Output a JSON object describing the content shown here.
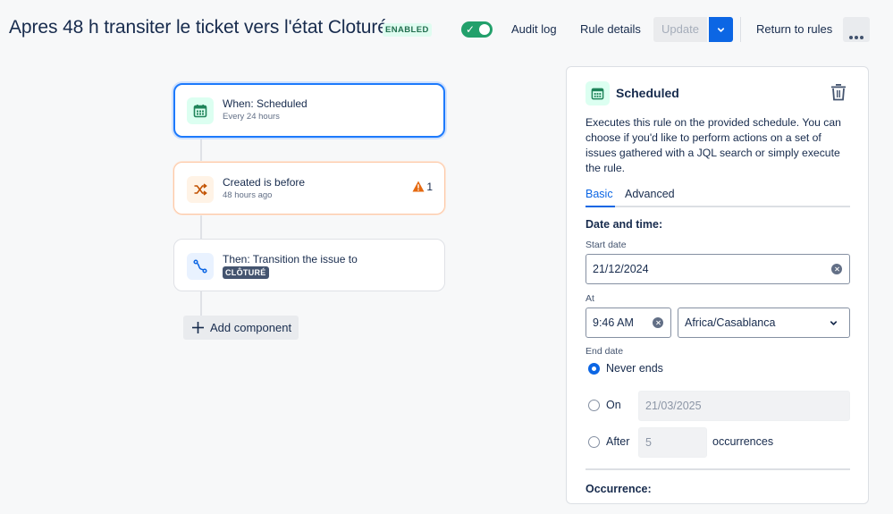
{
  "header": {
    "title": "Apres 48 h transiter le ticket vers l'état Cloturé",
    "status_lozenge": "ENABLED",
    "toggle_enabled": true,
    "audit_log_label": "Audit log",
    "rule_details_label": "Rule details",
    "update_label": "Update",
    "return_label": "Return to rules"
  },
  "flow": {
    "trigger": {
      "title": "When: Scheduled",
      "subtitle": "Every 24 hours",
      "icon": "calendar-icon"
    },
    "condition": {
      "title": "Created is before",
      "subtitle": "48 hours ago",
      "icon": "shuffle-icon",
      "warning_count": "1"
    },
    "action": {
      "title": "Then: Transition the issue to",
      "status": "CLÔTURÉ",
      "icon": "transition-icon"
    },
    "add_component_label": "Add component"
  },
  "panel": {
    "title": "Scheduled",
    "description": "Executes this rule on the provided schedule. You can choose if you'd like to perform actions on a set of issues gathered with a JQL search or simply execute the rule.",
    "tabs": [
      {
        "label": "Basic",
        "active": true
      },
      {
        "label": "Advanced",
        "active": false
      }
    ],
    "date_time_heading": "Date and time:",
    "start_date_label": "Start date",
    "start_date_value": "21/12/2024",
    "at_label": "At",
    "time_value": "9:46 AM",
    "timezone_value": "Africa/Casablanca",
    "end_date_label": "End date",
    "end_options": {
      "never": "Never ends",
      "on": "On",
      "on_date": "21/03/2025",
      "after": "After",
      "after_count": "5",
      "occurrences": "occurrences",
      "selected": "never"
    },
    "occurrence_heading": "Occurrence:"
  },
  "colors": {
    "accent": "#0c66e4",
    "enabled_green": "#22a06b",
    "warning_orange": "#e56910"
  }
}
